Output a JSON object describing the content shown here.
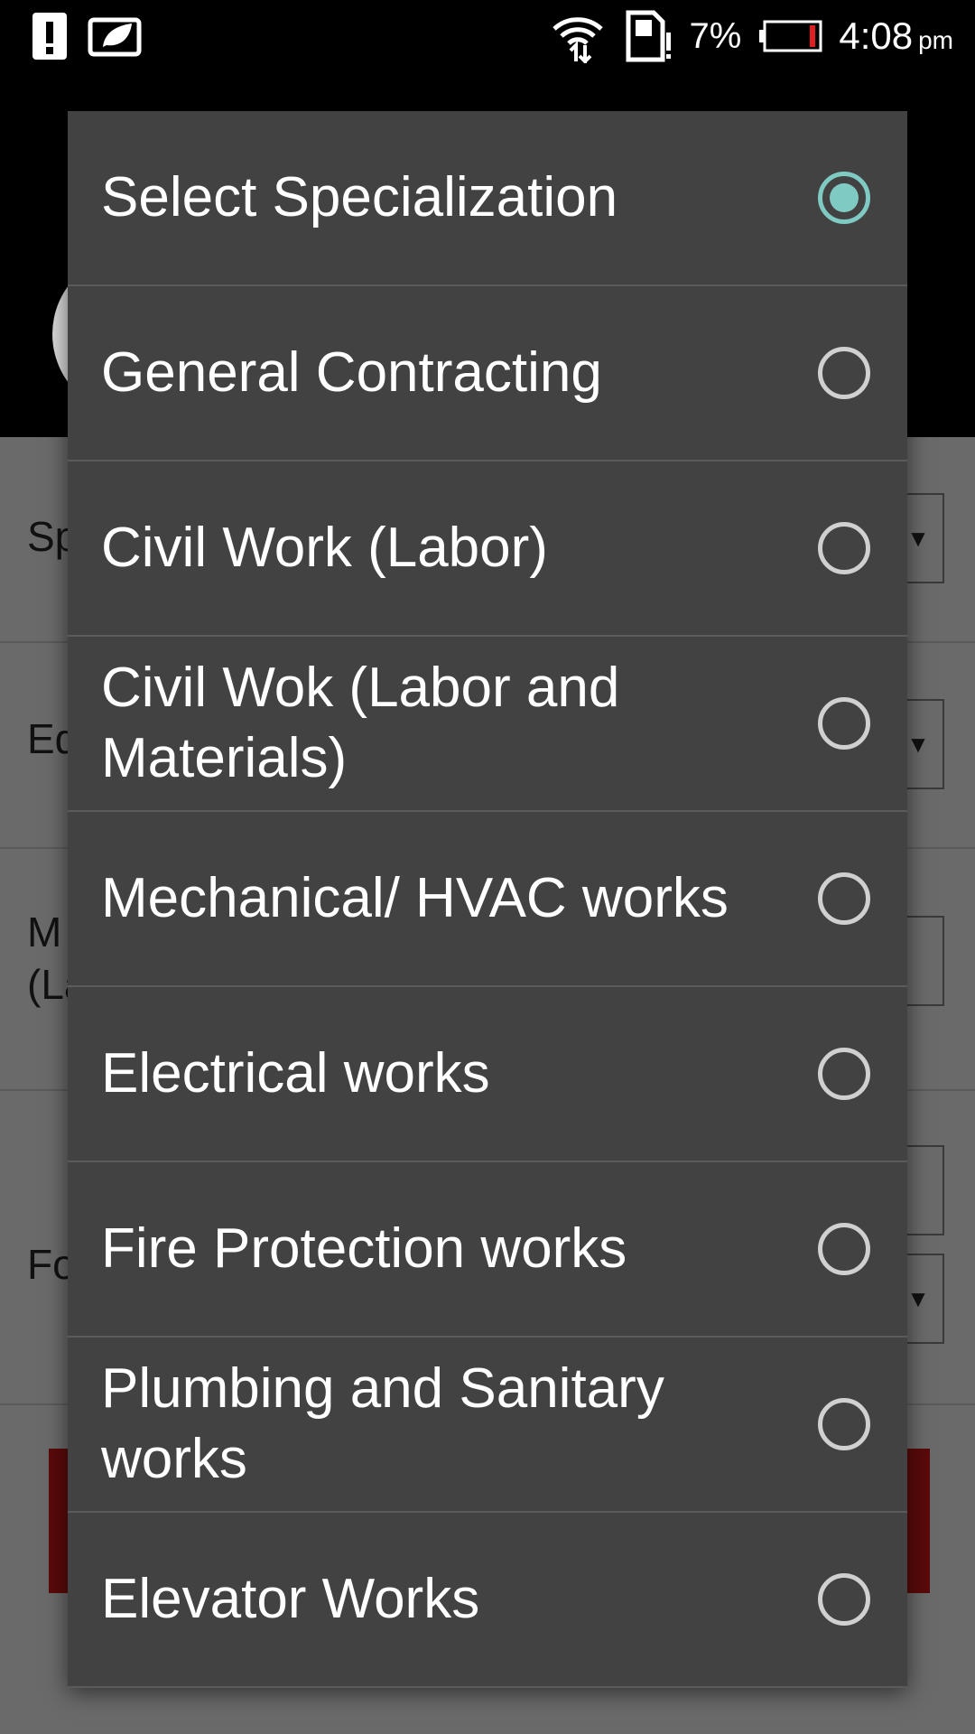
{
  "status_bar": {
    "battery_percent": "7%",
    "time": "4:08",
    "ampm": "pm",
    "icons": [
      "alert-icon",
      "leaf-icon",
      "wifi-icon",
      "sd-card-alert-icon",
      "battery-low-icon"
    ]
  },
  "background": {
    "form_labels": [
      "Sp",
      "Ed",
      "M",
      "(La",
      "Fo"
    ]
  },
  "dialog": {
    "options": [
      {
        "label": "Select Specialization",
        "checked": true
      },
      {
        "label": "General Contracting",
        "checked": false
      },
      {
        "label": "Civil Work (Labor)",
        "checked": false
      },
      {
        "label": "Civil Wok (Labor and Materials)",
        "checked": false
      },
      {
        "label": "Mechanical/ HVAC works",
        "checked": false
      },
      {
        "label": "Electrical works",
        "checked": false
      },
      {
        "label": "Fire Protection works",
        "checked": false
      },
      {
        "label": "Plumbing and Sanitary works",
        "checked": false
      },
      {
        "label": "Elevator Works",
        "checked": false
      }
    ]
  },
  "colors": {
    "dialog_bg": "#424242",
    "radio_accent": "#7fcbc4",
    "scrim": "#6a6a6a"
  }
}
